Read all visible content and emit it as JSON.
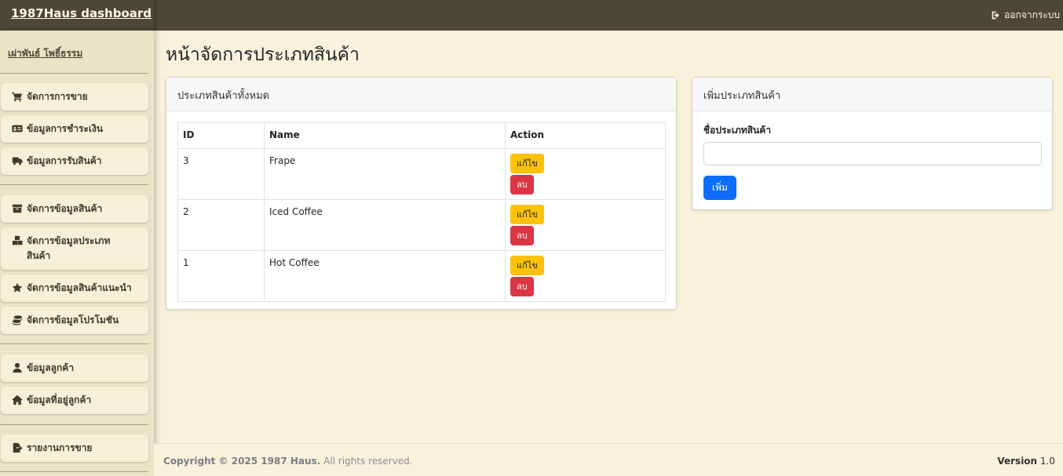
{
  "brand": "1987Haus dashboard",
  "logout": "ออกจากระบบ",
  "user": "เผ่าพันธ์ โพธิ์ธรรม",
  "nav": {
    "sales": "จัดการการขาย",
    "payments": "ข้อมูลการชำระเงิน",
    "receiving": "ข้อมูลการรับสินค้า",
    "products": "จัดการข้อมูลสินค้า",
    "categories_line1": "จัดการข้อมูลประเภท",
    "categories_line2": "สินค้า",
    "recommended": "จัดการข้อมูลสินค้าแนะนำ",
    "promotions": "จัดการข้อมูลโปรโมชัน",
    "customers": "ข้อมูลลูกค้า",
    "addresses": "ข้อมูลที่อยู่ลูกค้า",
    "report": "รายงานการขาย"
  },
  "page_title": "หน้าจัดการประเภทสินค้า",
  "list_card": {
    "title": "ประเภทสินค้าทั้งหมด",
    "columns": [
      "ID",
      "Name",
      "Action"
    ],
    "rows": [
      {
        "id": "3",
        "name": "Frape",
        "edit": "แก้ไข",
        "delete": "ลบ"
      },
      {
        "id": "2",
        "name": "Iced Coffee",
        "edit": "แก้ไข",
        "delete": "ลบ"
      },
      {
        "id": "1",
        "name": "Hot Coffee",
        "edit": "แก้ไข",
        "delete": "ลบ"
      }
    ]
  },
  "add_card": {
    "title": "เพิ่มประเภทสินค้า",
    "field_label": "ชื่อประเภทสินค้า",
    "field_value": "",
    "submit": "เพิ่ม"
  },
  "footer": {
    "copyright_bold": "Copyright © 2025 1987 Haus.",
    "copyright_rest": " All rights reserved.",
    "version_label": "Version",
    "version_value": " 1.0"
  },
  "colors": {
    "topbar": "#4b4838",
    "sidebar": "#ebe3c5",
    "background": "#f8f1dc",
    "edit": "#ffc107",
    "delete": "#dc3545",
    "primary": "#0d6efd"
  }
}
